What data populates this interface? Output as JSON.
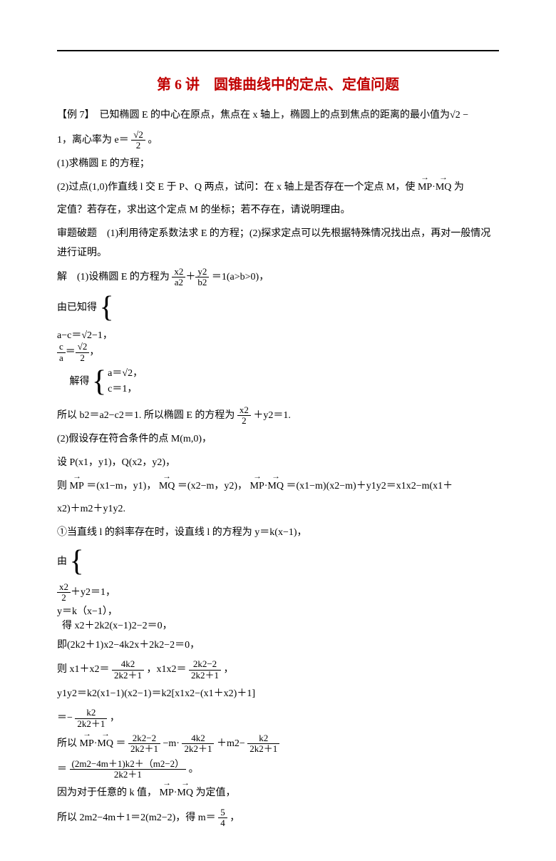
{
  "title": "第 6 讲　圆锥曲线中的定点、定值问题",
  "p1": "【例 7】　已知椭圆 E 的中心在原点，焦点在 x 轴上，椭圆上的点到焦点的距离的最小值为√2 −",
  "p2a": "1，离心率为 e＝",
  "p2b": "。",
  "p3": "(1)求椭圆 E 的方程；",
  "p4": "(2)过点(1,0)作直线 l 交 E 于 P、Q 两点，试问：在 x 轴上是否存在一个定点 M，使",
  "p4b": "为",
  "p5": "定值？若存在，求出这个定点 M 的坐标；若不存在，请说明理由。",
  "p6": "审题破题　(1)利用待定系数法求 E 的方程；(2)探求定点可以先根据特殊情况找出点，再对一般情况进行证明。",
  "p7a": "解　(1)设椭圆 E 的方程为",
  "p7b": "＝1(a>b>0)，",
  "p8a": "由已知得",
  "p8b": "解得",
  "br1r1": "a−c＝√2−1，",
  "br1r2a": "＝",
  "br1r2b": "，",
  "br2r1": "a＝√2，",
  "br2r2": "c＝1，",
  "p9a": "所以 b2＝a2−c2＝1. 所以椭圆 E 的方程为",
  "p9b": "＋y2＝1.",
  "p10": "(2)假设存在符合条件的点 M(m,0)，",
  "p11": "设 P(x1，y1)，Q(x2，y2)，",
  "p12a": "则",
  "p12b": "＝(x1−m，y1)，",
  "p12c": "＝(x2−m，y2)，",
  "p12d": "＝(x1−m)(x2−m)＋y1y2＝x1x2−m(x1＋",
  "p13": "x2)＋m2＋y1y2.",
  "p14": "①当直线 l 的斜率存在时，设直线 l 的方程为 y＝k(x−1)，",
  "p15a": "由",
  "br3r1": "＋y2＝1，",
  "br3r2": "y＝k（x−1），",
  "p15b": "得 x2＋2k2(x−1)2−2＝0，",
  "p16": "即(2k2＋1)x2−4k2x＋2k2−2＝0，",
  "p17a": "则 x1＋x2＝",
  "p17b": "，x1x2＝",
  "p17c": "，",
  "p18": "y1y2＝k2(x1−1)(x2−1)＝k2[x1x2−(x1＋x2)＋1]",
  "p19a": "＝−",
  "p19b": "，",
  "p20a": "所以",
  "p20b": "＝",
  "p20c": "−m·",
  "p20d": "＋m2−",
  "p21a": "＝",
  "p21b": "。",
  "p22a": "因为对于任意的 k 值，",
  "p22b": "为定值，",
  "p23a": "所以 2m2−4m＋1＝2(m2−2)，得 m＝",
  "p23b": "，",
  "frac_root2_2_num": "√2",
  "frac_root2_2_den": "2",
  "frac_ab_num": "x2",
  "frac_ab_mid": "a2",
  "frac_ab_num2": "y2",
  "frac_ab_den2": "b2",
  "frac_ca_num": "c",
  "frac_ca_den": "a",
  "frac_x2_2_num": "x2",
  "frac_x2_2_den": "2",
  "frac_4k2_num": "4k2",
  "frac_2k21_den": "2k2＋1",
  "frac_2k22_num": "2k2−2",
  "frac_k2_num": "k2",
  "frac_big_num": "(2m2−4m＋1)k2＋（m2−2）",
  "frac_54_num": "5",
  "frac_54_den": "4",
  "vec_MP": "MP",
  "vec_MQ": "MQ",
  "dot": "·"
}
